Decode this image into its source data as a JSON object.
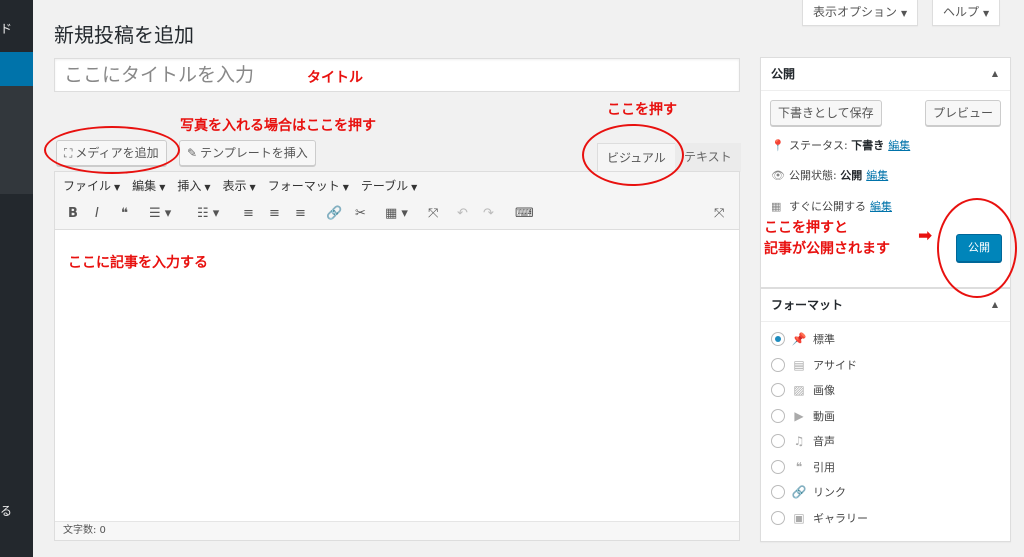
{
  "admin_menu": {
    "top_fragment": "ド",
    "bottom_fragment": "る"
  },
  "screen_options": {
    "label": "表示オプション",
    "help": "ヘルプ"
  },
  "page_title": "新規投稿を追加",
  "title_input": {
    "placeholder": "ここにタイトルを入力"
  },
  "media_buttons": {
    "add_media": "メディアを追加",
    "insert_template": "テンプレートを挿入"
  },
  "editor": {
    "tabs": {
      "visual": "ビジュアル",
      "text": "テキスト"
    },
    "menu": [
      "ファイル",
      "編集",
      "挿入",
      "表示",
      "フォーマット",
      "テーブル"
    ],
    "toolbar": [
      {
        "name": "bold-button",
        "glyph": "B"
      },
      {
        "name": "italic-button",
        "glyph": "I"
      },
      {
        "name": "blockquote-button",
        "glyph": "❝"
      },
      {
        "name": "bullet-list-button",
        "glyph": "☰ ▾"
      },
      {
        "name": "numbered-list-button",
        "glyph": "☷ ▾"
      },
      {
        "name": "align-left-button",
        "glyph": "≡"
      },
      {
        "name": "align-center-button",
        "glyph": "≡"
      },
      {
        "name": "align-right-button",
        "glyph": "≡"
      },
      {
        "name": "insert-link-button",
        "glyph": "🔗"
      },
      {
        "name": "remove-link-button",
        "glyph": "✂"
      },
      {
        "name": "table-button",
        "glyph": "▦ ▾"
      },
      {
        "name": "fullscreen-button",
        "glyph": "⤧"
      },
      {
        "name": "undo-button",
        "glyph": "↶"
      },
      {
        "name": "redo-button",
        "glyph": "↷"
      },
      {
        "name": "keyboard-button",
        "glyph": "⌨"
      }
    ],
    "word_count": "文字数: 0"
  },
  "publish_box": {
    "title": "公開",
    "save_draft": "下書きとして保存",
    "preview": "プレビュー",
    "status_label": "ステータス:",
    "status_value": "下書き",
    "visibility_label": "公開状態:",
    "visibility_value": "公開",
    "schedule_label": "すぐに公開する",
    "edit_link": "編集",
    "publish_button": "公開"
  },
  "format_box": {
    "title": "フォーマット",
    "options": [
      "標準",
      "アサイド",
      "画像",
      "動画",
      "音声",
      "引用",
      "リンク",
      "ギャラリー"
    ],
    "selected": "標準"
  },
  "annotations": {
    "title": "タイトル",
    "photo": "写真を入れる場合はここを押す",
    "press_here": "ここを押す",
    "write_article": "ここに記事を入力する",
    "publish_line1": "ここを押すと",
    "publish_line2": "記事が公開されます"
  },
  "colors": {
    "annotation": "#e8110f",
    "primary_button": "#0085ba",
    "admin_bar": "#23282d",
    "link": "#0073aa"
  }
}
